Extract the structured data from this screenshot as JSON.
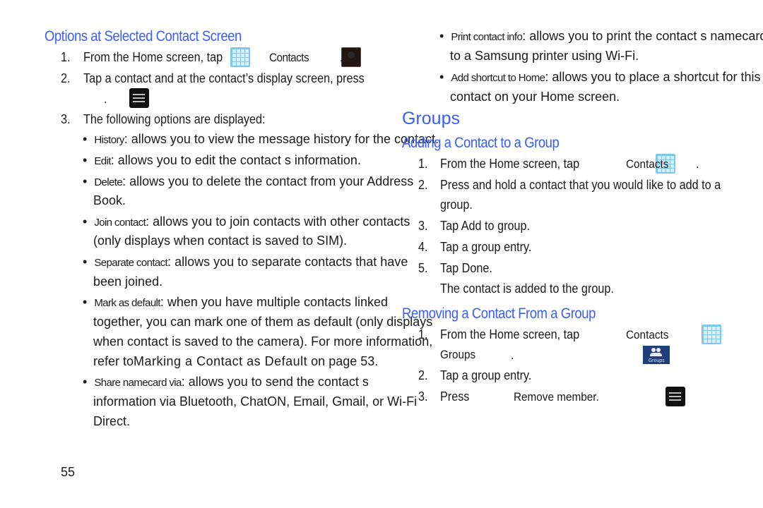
{
  "left": {
    "heading": "Options at Selected Contact Screen",
    "steps": [
      {
        "num": "1.",
        "text_a": "From the Home screen, tap",
        "text_b": "Contacts",
        "text_c": "."
      },
      {
        "num": "2.",
        "text_a": "Tap a contact and at the contact’s display screen, press",
        "text_c": "."
      },
      {
        "num": "3.",
        "text_a": "The following options are displayed:"
      }
    ],
    "bullets": [
      {
        "label": "History",
        "lines": [
          ": allows you to view the message history for the contact."
        ]
      },
      {
        "label": "Edit",
        "lines": [
          ": allows you to edit the contact s information."
        ]
      },
      {
        "label": "Delete",
        "lines": [
          ": allows you to delete the contact from your Address",
          "Book."
        ]
      },
      {
        "label": "Join contact",
        "lines": [
          ": allows you to join contacts with other contacts",
          "(only displays when contact is saved to SIM)."
        ]
      },
      {
        "label": "Separate contact",
        "lines": [
          ": allows you to separate contacts that have",
          "been joined."
        ]
      },
      {
        "label": "Mark as default",
        "lines": [
          ": when you have multiple contacts linked",
          "together, you can mark one of them as default (only displays",
          "when contact is saved to the camera). For more information,",
          "refer to",
          "Marking a Contact as Default",
          "on page 53."
        ]
      },
      {
        "label": "Share namecard via",
        "lines": [
          ": allows you to send the contact s",
          "information via Bluetooth, ChatON, Email, Gmail, or Wi-Fi",
          "Direct."
        ]
      }
    ],
    "page_number": "55"
  },
  "right": {
    "bullets": [
      {
        "label": "Print contact info",
        "lines": [
          ": allows you to print the contact s namecard",
          "to a Samsung printer using Wi-Fi."
        ]
      },
      {
        "label": "Add shortcut to Home",
        "lines": [
          ": allows you to place a shortcut for this",
          "contact on your Home screen."
        ]
      }
    ],
    "section_title": "Groups",
    "adding": {
      "heading": "Adding a Contact to a Group",
      "steps": [
        {
          "num": "1.",
          "text_a": "From the Home screen, tap",
          "text_b": "Contacts",
          "text_c": "."
        },
        {
          "num": "2.",
          "lines": [
            "Press and hold a contact that you would like to add to a",
            "group."
          ]
        },
        {
          "num": "3.",
          "text_a": "Tap ",
          "text_b": "Add to group",
          "text_c": "."
        },
        {
          "num": "4.",
          "text_a": "Tap a group entry."
        },
        {
          "num": "5.",
          "text_a": "Tap ",
          "text_b": "Done",
          "text_c": "."
        }
      ],
      "result": "The contact is added to the group."
    },
    "removing": {
      "heading": "Removing a Contact From a Group",
      "steps": [
        {
          "num": "1.",
          "text_a": "From the Home screen, tap",
          "text_b": "Contacts",
          "text_d": "Groups",
          "text_c": "."
        },
        {
          "num": "2.",
          "text_a": "Tap a group entry."
        },
        {
          "num": "3.",
          "text_a": "Press",
          "text_b": "Remove member."
        }
      ],
      "groups_icon_label": "Groups"
    }
  },
  "colors": {
    "heading": "#3a5ff0",
    "apps_icon": "#7cc7ec",
    "contacts_orange": "#e9651b",
    "groups_icon": "#1f3f7a"
  }
}
